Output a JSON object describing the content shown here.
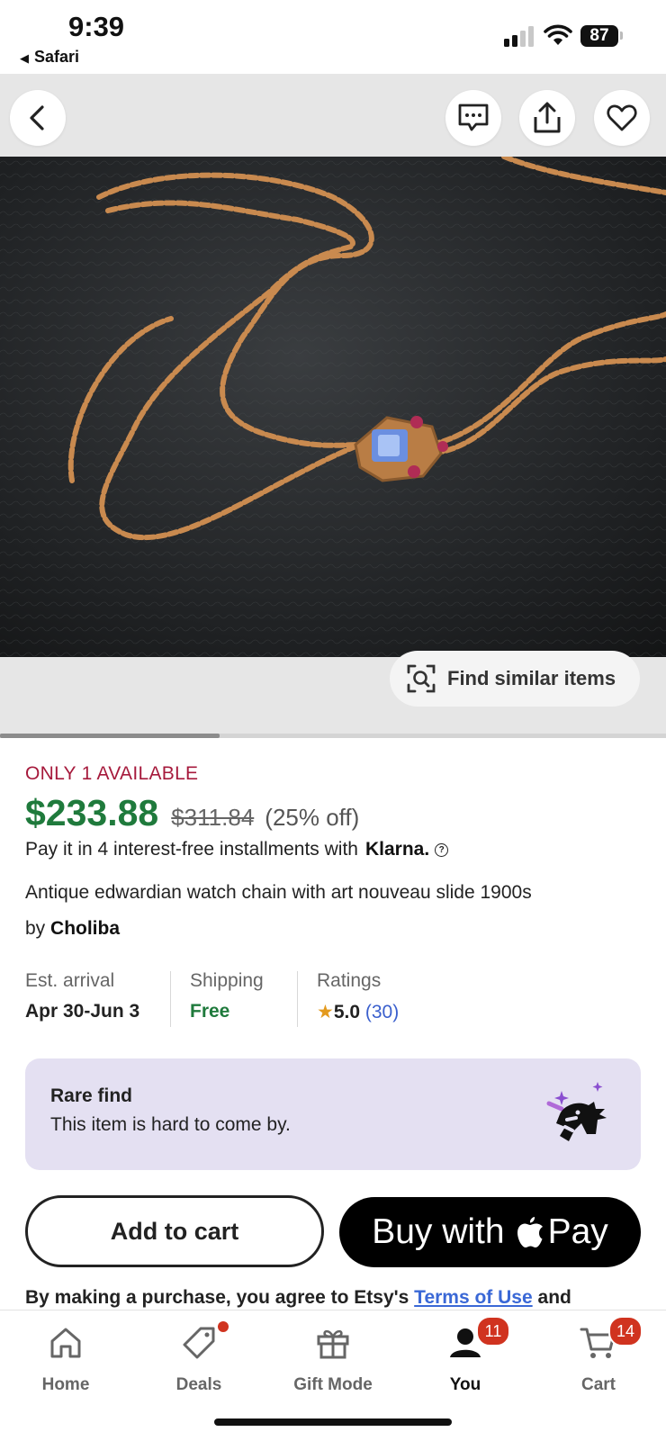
{
  "status_bar": {
    "time": "9:39",
    "back_app": "Safari",
    "battery": "87"
  },
  "gallery": {
    "find_similar_label": "Find similar items",
    "carousel_progress": 0.33
  },
  "product": {
    "availability": "ONLY 1 AVAILABLE",
    "price": "$233.88",
    "original_price": "$311.84",
    "discount": "(25% off)",
    "installments_text": "Pay it in 4 interest-free installments with",
    "installments_provider": "Klarna.",
    "title": "Antique edwardian watch chain with art nouveau slide 1900s",
    "by_label": "by",
    "shop_name": "Choliba"
  },
  "meta": {
    "arrival_label": "Est. arrival",
    "arrival_value": "Apr 30-Jun 3",
    "shipping_label": "Shipping",
    "shipping_value": "Free",
    "ratings_label": "Ratings",
    "rating_value": "5.0",
    "rating_count": "(30)"
  },
  "rare_find": {
    "title": "Rare find",
    "text": "This item is hard to come by."
  },
  "actions": {
    "add_to_cart": "Add to cart",
    "buy_with": "Buy with",
    "pay": "Pay"
  },
  "terms": {
    "prefix": "By making a purchase, you agree to Etsy's",
    "link": "Terms of Use",
    "suffix": "and"
  },
  "tab_bar": {
    "items": [
      {
        "label": "Home",
        "icon": "home-icon"
      },
      {
        "label": "Deals",
        "icon": "tag-icon"
      },
      {
        "label": "Gift Mode",
        "icon": "gift-icon"
      },
      {
        "label": "You",
        "icon": "person-icon",
        "badge": "11"
      },
      {
        "label": "Cart",
        "icon": "cart-icon",
        "badge": "14"
      }
    ]
  },
  "colors": {
    "price_green": "#1f7a3c",
    "availability_red": "#a61a3c",
    "link_blue": "#3a68d6",
    "badge_red": "#d0331f",
    "rare_bg": "#e4e0f2"
  }
}
